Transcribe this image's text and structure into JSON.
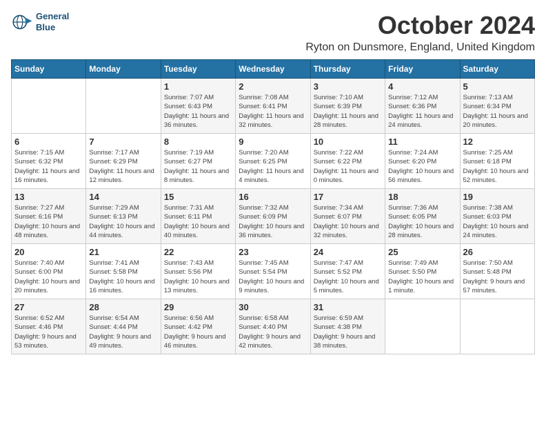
{
  "header": {
    "logo_line1": "General",
    "logo_line2": "Blue",
    "month": "October 2024",
    "location": "Ryton on Dunsmore, England, United Kingdom"
  },
  "days_of_week": [
    "Sunday",
    "Monday",
    "Tuesday",
    "Wednesday",
    "Thursday",
    "Friday",
    "Saturday"
  ],
  "weeks": [
    [
      {
        "day": "",
        "detail": ""
      },
      {
        "day": "",
        "detail": ""
      },
      {
        "day": "1",
        "detail": "Sunrise: 7:07 AM\nSunset: 6:43 PM\nDaylight: 11 hours\nand 36 minutes."
      },
      {
        "day": "2",
        "detail": "Sunrise: 7:08 AM\nSunset: 6:41 PM\nDaylight: 11 hours\nand 32 minutes."
      },
      {
        "day": "3",
        "detail": "Sunrise: 7:10 AM\nSunset: 6:39 PM\nDaylight: 11 hours\nand 28 minutes."
      },
      {
        "day": "4",
        "detail": "Sunrise: 7:12 AM\nSunset: 6:36 PM\nDaylight: 11 hours\nand 24 minutes."
      },
      {
        "day": "5",
        "detail": "Sunrise: 7:13 AM\nSunset: 6:34 PM\nDaylight: 11 hours\nand 20 minutes."
      }
    ],
    [
      {
        "day": "6",
        "detail": "Sunrise: 7:15 AM\nSunset: 6:32 PM\nDaylight: 11 hours\nand 16 minutes."
      },
      {
        "day": "7",
        "detail": "Sunrise: 7:17 AM\nSunset: 6:29 PM\nDaylight: 11 hours\nand 12 minutes."
      },
      {
        "day": "8",
        "detail": "Sunrise: 7:19 AM\nSunset: 6:27 PM\nDaylight: 11 hours\nand 8 minutes."
      },
      {
        "day": "9",
        "detail": "Sunrise: 7:20 AM\nSunset: 6:25 PM\nDaylight: 11 hours\nand 4 minutes."
      },
      {
        "day": "10",
        "detail": "Sunrise: 7:22 AM\nSunset: 6:22 PM\nDaylight: 11 hours\nand 0 minutes."
      },
      {
        "day": "11",
        "detail": "Sunrise: 7:24 AM\nSunset: 6:20 PM\nDaylight: 10 hours\nand 56 minutes."
      },
      {
        "day": "12",
        "detail": "Sunrise: 7:25 AM\nSunset: 6:18 PM\nDaylight: 10 hours\nand 52 minutes."
      }
    ],
    [
      {
        "day": "13",
        "detail": "Sunrise: 7:27 AM\nSunset: 6:16 PM\nDaylight: 10 hours\nand 48 minutes."
      },
      {
        "day": "14",
        "detail": "Sunrise: 7:29 AM\nSunset: 6:13 PM\nDaylight: 10 hours\nand 44 minutes."
      },
      {
        "day": "15",
        "detail": "Sunrise: 7:31 AM\nSunset: 6:11 PM\nDaylight: 10 hours\nand 40 minutes."
      },
      {
        "day": "16",
        "detail": "Sunrise: 7:32 AM\nSunset: 6:09 PM\nDaylight: 10 hours\nand 36 minutes."
      },
      {
        "day": "17",
        "detail": "Sunrise: 7:34 AM\nSunset: 6:07 PM\nDaylight: 10 hours\nand 32 minutes."
      },
      {
        "day": "18",
        "detail": "Sunrise: 7:36 AM\nSunset: 6:05 PM\nDaylight: 10 hours\nand 28 minutes."
      },
      {
        "day": "19",
        "detail": "Sunrise: 7:38 AM\nSunset: 6:03 PM\nDaylight: 10 hours\nand 24 minutes."
      }
    ],
    [
      {
        "day": "20",
        "detail": "Sunrise: 7:40 AM\nSunset: 6:00 PM\nDaylight: 10 hours\nand 20 minutes."
      },
      {
        "day": "21",
        "detail": "Sunrise: 7:41 AM\nSunset: 5:58 PM\nDaylight: 10 hours\nand 16 minutes."
      },
      {
        "day": "22",
        "detail": "Sunrise: 7:43 AM\nSunset: 5:56 PM\nDaylight: 10 hours\nand 13 minutes."
      },
      {
        "day": "23",
        "detail": "Sunrise: 7:45 AM\nSunset: 5:54 PM\nDaylight: 10 hours\nand 9 minutes."
      },
      {
        "day": "24",
        "detail": "Sunrise: 7:47 AM\nSunset: 5:52 PM\nDaylight: 10 hours\nand 5 minutes."
      },
      {
        "day": "25",
        "detail": "Sunrise: 7:49 AM\nSunset: 5:50 PM\nDaylight: 10 hours\nand 1 minute."
      },
      {
        "day": "26",
        "detail": "Sunrise: 7:50 AM\nSunset: 5:48 PM\nDaylight: 9 hours\nand 57 minutes."
      }
    ],
    [
      {
        "day": "27",
        "detail": "Sunrise: 6:52 AM\nSunset: 4:46 PM\nDaylight: 9 hours\nand 53 minutes."
      },
      {
        "day": "28",
        "detail": "Sunrise: 6:54 AM\nSunset: 4:44 PM\nDaylight: 9 hours\nand 49 minutes."
      },
      {
        "day": "29",
        "detail": "Sunrise: 6:56 AM\nSunset: 4:42 PM\nDaylight: 9 hours\nand 46 minutes."
      },
      {
        "day": "30",
        "detail": "Sunrise: 6:58 AM\nSunset: 4:40 PM\nDaylight: 9 hours\nand 42 minutes."
      },
      {
        "day": "31",
        "detail": "Sunrise: 6:59 AM\nSunset: 4:38 PM\nDaylight: 9 hours\nand 38 minutes."
      },
      {
        "day": "",
        "detail": ""
      },
      {
        "day": "",
        "detail": ""
      }
    ]
  ]
}
